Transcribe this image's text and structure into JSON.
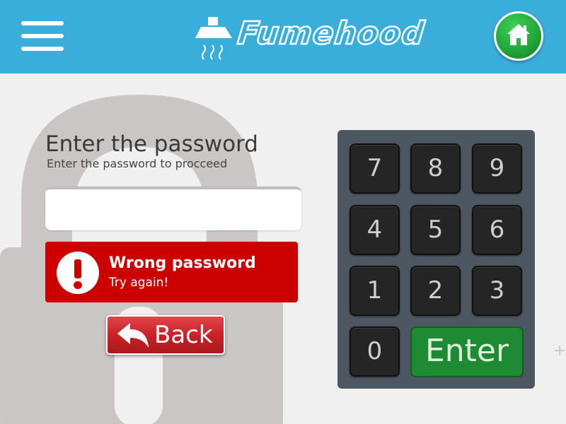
{
  "header": {
    "brand": "Fumehood",
    "colors": {
      "bar": "#3aaedb",
      "home": "#22a83a"
    }
  },
  "form": {
    "title": "Enter the password",
    "subtitle": "Enter the password to procceed",
    "password_value": "",
    "error_title": "Wrong password",
    "error_subtitle": "Try again!",
    "back_label": "Back"
  },
  "keypad": {
    "keys": [
      "7",
      "8",
      "9",
      "4",
      "5",
      "6",
      "1",
      "2",
      "3",
      "0"
    ],
    "enter_label": "Enter"
  },
  "icons": [
    "menu-icon",
    "fume-hood-icon",
    "home-icon",
    "padlock-icon",
    "exclamation-icon",
    "back-arrow-icon"
  ]
}
